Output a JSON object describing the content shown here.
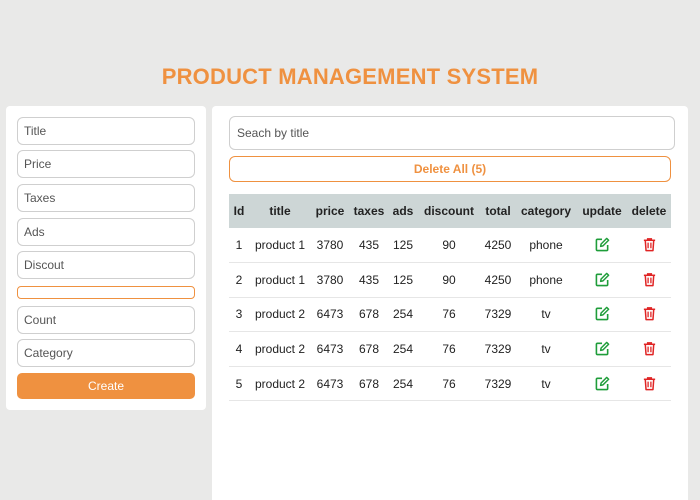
{
  "header": {
    "title": "PRODUCT MANAGEMENT SYSTEM"
  },
  "form": {
    "title_placeholder": "Title",
    "price_placeholder": "Price",
    "taxes_placeholder": "Taxes",
    "ads_placeholder": "Ads",
    "discount_placeholder": "Discout",
    "count_placeholder": "Count",
    "category_placeholder": "Category",
    "create_label": "Create"
  },
  "search": {
    "placeholder": "Seach by title"
  },
  "delete_all_label": "Delete All (5)",
  "table": {
    "headers": [
      "Id",
      "title",
      "price",
      "taxes",
      "ads",
      "discount",
      "total",
      "category",
      "update",
      "delete"
    ],
    "rows": [
      [
        "1",
        "product 1",
        "3780",
        "435",
        "125",
        "90",
        "4250",
        "phone"
      ],
      [
        "2",
        "product 1",
        "3780",
        "435",
        "125",
        "90",
        "4250",
        "phone"
      ],
      [
        "3",
        "product 2",
        "6473",
        "678",
        "254",
        "76",
        "7329",
        "tv"
      ],
      [
        "4",
        "product 2",
        "6473",
        "678",
        "254",
        "76",
        "7329",
        "tv"
      ],
      [
        "5",
        "product 2",
        "6473",
        "678",
        "254",
        "76",
        "7329",
        "tv"
      ]
    ]
  },
  "icons": {
    "update": "edit-icon",
    "delete": "trash-icon"
  },
  "colors": {
    "accent": "#ef9140",
    "update_icon": "#1f9d3a",
    "delete_icon": "#e02424",
    "header_row": "#cdd6d6"
  }
}
